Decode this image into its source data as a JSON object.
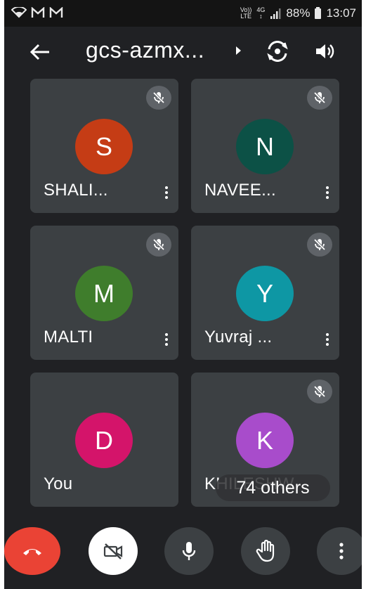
{
  "status_bar": {
    "notification_icons": [
      "wifi-icon",
      "gmail-icon",
      "gmail-icon"
    ],
    "volte": "Vo))",
    "lte": "LTE",
    "network": "4G",
    "battery": "88%",
    "time": "13:07"
  },
  "top_bar": {
    "meeting_title": "gcs-azmx..."
  },
  "participants": [
    {
      "initial": "S",
      "name": "SHALI...",
      "color": "#c53c15",
      "muted": true
    },
    {
      "initial": "N",
      "name": "NAVEE...",
      "color": "#0c5146",
      "muted": true
    },
    {
      "initial": "M",
      "name": "MALTI",
      "color": "#3f7d2c",
      "muted": true
    },
    {
      "initial": "Y",
      "name": "Yuvraj ...",
      "color": "#0e97a4",
      "muted": true
    },
    {
      "initial": "D",
      "name": "You",
      "color": "#d4146a",
      "muted": false
    },
    {
      "initial": "K",
      "name": "KHILESHW",
      "color": "#a84ccb",
      "muted": true
    }
  ],
  "others_pill": "74 others",
  "controls": [
    "end-call",
    "camera-off",
    "microphone",
    "raise-hand",
    "more-options"
  ],
  "colors": {
    "background": "#202124",
    "tile": "#3c4043",
    "end_call": "#ea4335"
  }
}
